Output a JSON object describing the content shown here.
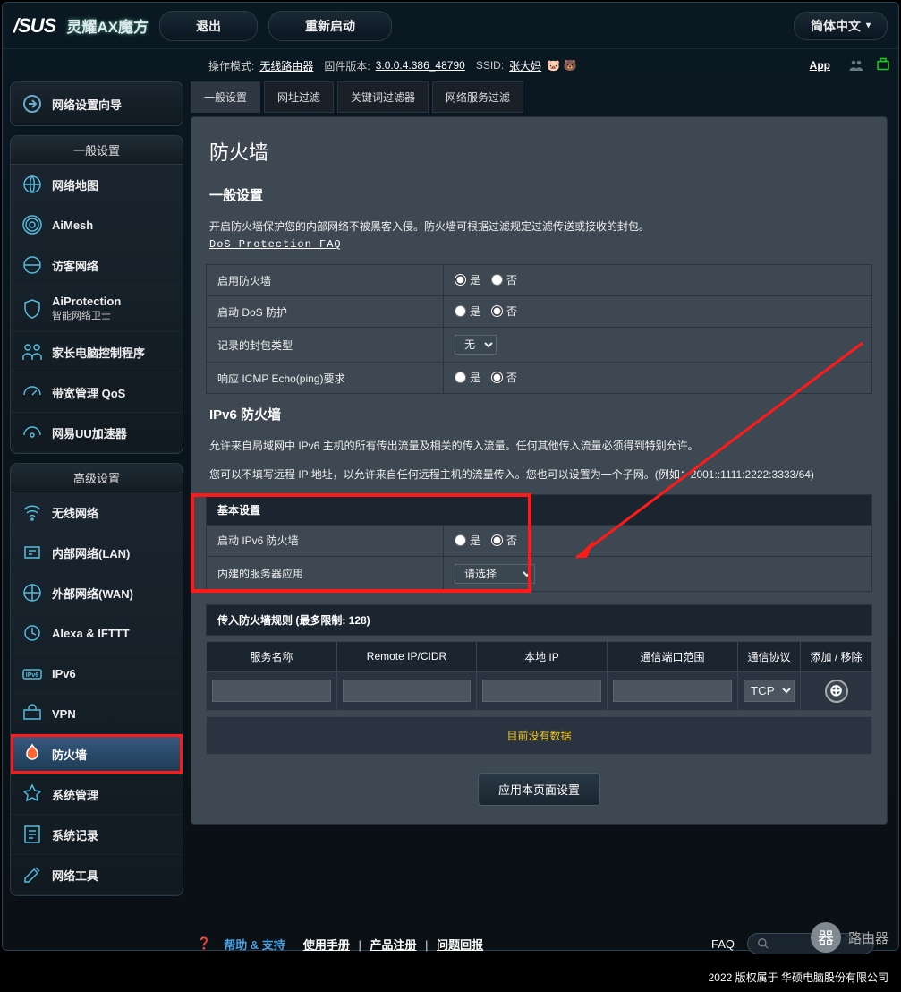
{
  "header": {
    "logo": "/SUS",
    "model": "灵耀AX魔方",
    "logout": "退出",
    "reboot": "重新启动",
    "language": "简体中文"
  },
  "status": {
    "opmode_label": "操作模式:",
    "opmode": "无线路由器",
    "fw_label": "固件版本:",
    "fw": "3.0.0.4.386_48790",
    "ssid_label": "SSID:",
    "ssid": "张大妈",
    "app": "App"
  },
  "sidebar": {
    "wizard": "网络设置向导",
    "general_title": "一般设置",
    "general": [
      "网络地图",
      "AiMesh",
      "访客网络",
      "AiProtection",
      "智能网络卫士",
      "家长电脑控制程序",
      "带宽管理 QoS",
      "网易UU加速器"
    ],
    "adv_title": "高级设置",
    "adv": [
      "无线网络",
      "内部网络(LAN)",
      "外部网络(WAN)",
      "Alexa & IFTTT",
      "IPv6",
      "VPN",
      "防火墙",
      "系统管理",
      "系统记录",
      "网络工具"
    ]
  },
  "tabs": [
    "一般设置",
    "网址过滤",
    "关键词过滤器",
    "网络服务过滤"
  ],
  "page": {
    "title": "防火墙",
    "section1_title": "一般设置",
    "section1_desc": "开启防火墙保护您的内部网络不被黑客入侵。防火墙可根据过滤规定过滤传送或接收的封包。",
    "faq": "DoS Protection FAQ",
    "row_enable_fw": "启用防火墙",
    "row_enable_dos": "启动 DoS 防护",
    "row_pkt_type": "记录的封包类型",
    "pkt_type_val": "无",
    "row_icmp": "响应 ICMP Echo(ping)要求",
    "yes": "是",
    "no": "否",
    "ipv6_title": "IPv6 防火墙",
    "ipv6_desc1": "允许来自局域网中 IPv6 主机的所有传出流量及相关的传入流量。任何其他传入流量必须得到特别允许。",
    "ipv6_desc2": "您可以不填写远程 IP 地址，以允许来自任何远程主机的流量传入。您也可以设置为一个子网。(例如：2001::1111:2222:3333/64)",
    "basic": "基本设置",
    "row_ipv6_fw": "启动 IPv6 防火墙",
    "row_server_app": "内建的服务器应用",
    "server_app_placeholder": "请选择",
    "rules_header": "传入防火墙规则 (最多限制: 128)",
    "cols": {
      "service": "服务名称",
      "remote": "Remote IP/CIDR",
      "local": "本地 IP",
      "port": "通信端口范围",
      "proto": "通信协议",
      "add": "添加 / 移除"
    },
    "proto_default": "TCP",
    "nodata": "目前没有数据",
    "apply": "应用本页面设置"
  },
  "footer": {
    "help": "帮助 & 支持",
    "manual": "使用手册",
    "register": "产品注册",
    "feedback": "问题回报",
    "faq": "FAQ",
    "copyright": "2022 版权属于 华硕电脑股份有限公司"
  },
  "watermark": "路由器"
}
